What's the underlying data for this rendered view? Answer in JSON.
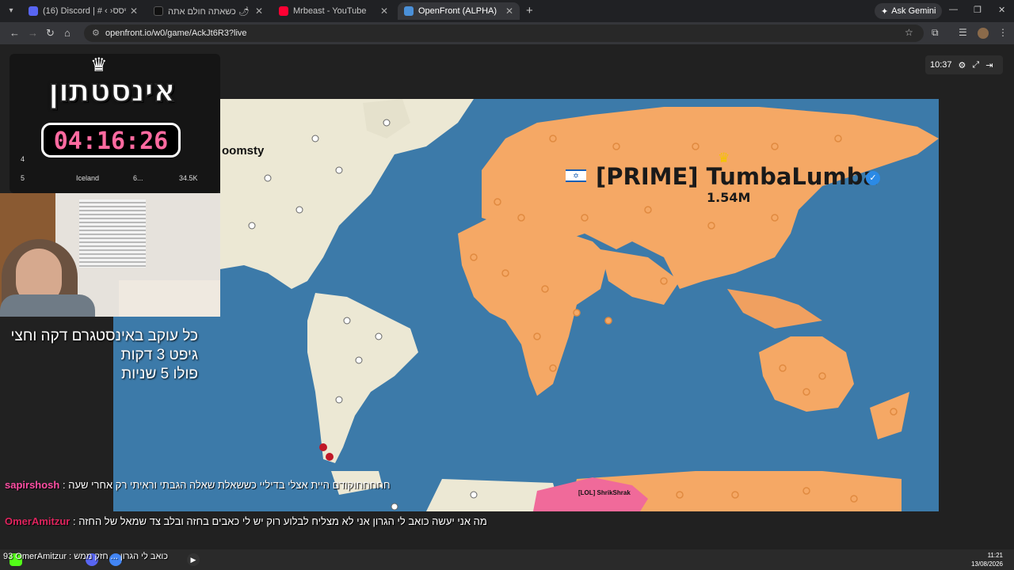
{
  "browser": {
    "tabs": [
      {
        "title": "(16) Discord | # ‹ ›מיסס & ‹ ›",
        "color": "#5865f2",
        "active": false
      },
      {
        "title": "גבר נגיש 🌶 כשאתה חולם אתה",
        "color": "#111111",
        "active": false
      },
      {
        "title": "Mrbeast - YouTube",
        "color": "#ff0033",
        "active": false
      },
      {
        "title": "OpenFront (ALPHA)",
        "color": "#4a90d9",
        "active": true
      }
    ],
    "ask_gemini": "Ask Gemini",
    "url": "openfront.io/w0/game/AckJt6R3?live"
  },
  "game": {
    "hud_time": "10:37",
    "player": {
      "name": "[PRIME] TumbaLumba",
      "troops": "1.54M",
      "territory_color": "#f5a865",
      "verified": true
    },
    "other_labels": {
      "partial_name": "oomsty",
      "lol_player": "[LOL] ShrikShrak"
    },
    "colors": {
      "ocean": "#3c7aa9",
      "neutral_land": "#ece8d4",
      "pink_player": "#f06a9a"
    }
  },
  "stream": {
    "timer_title": "אינסטתון",
    "timer_value": "04:16:26",
    "leaderboard": [
      {
        "rank": "4",
        "name": "",
        "v1": "",
        "v2": ""
      },
      {
        "rank": "5",
        "name": "Iceland",
        "v1": "6...",
        "v2": "34.5K"
      }
    ],
    "overlay_lines": [
      "כל עוקב באינסטגרם דקה וחצי",
      "גיפט 3 דקות",
      "פולו 5 שניות"
    ],
    "chat": [
      {
        "user": "sapirshosh",
        "user_color": "#ff4fa3",
        "text": ": חחחחחוקודם היית אצלי בדיליי כששאלת שאלה הגבתי וראיתי רק אחרי שעה"
      },
      {
        "user": "OmerAmitzur",
        "user_color": "#e0245e",
        "text": ": מה אני יעשה כואב לי הגרון אני לא מצליח לבלוע רוק יש לי כאבים בחזה ובלב צד שמאל של החזה"
      }
    ],
    "ticker": "93 OmerAmitzur : כואב לי הגרון ... חזק ממש"
  },
  "taskbar": {
    "time": "11:21",
    "date": "13/08/2026"
  }
}
